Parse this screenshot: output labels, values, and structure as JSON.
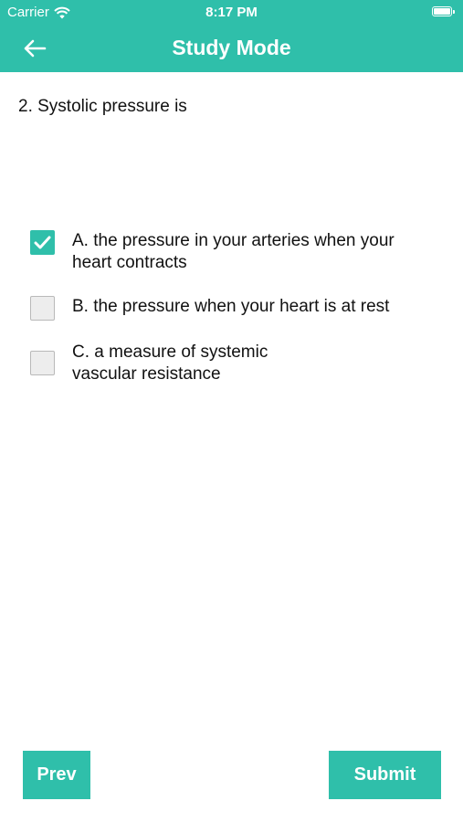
{
  "status_bar": {
    "carrier": "Carrier",
    "time": "8:17 PM"
  },
  "header": {
    "title": "Study Mode",
    "back_icon": "arrow-left-icon"
  },
  "question": {
    "text": "2. Systolic pressure is"
  },
  "options": [
    {
      "label": "A. the pressure in your arteries when your\nheart contracts",
      "checked": true
    },
    {
      "label": "B. the pressure when your heart is at rest",
      "checked": false
    },
    {
      "label": "C. a measure of systemic\nvascular resistance",
      "checked": false
    }
  ],
  "footer": {
    "prev_label": "Prev",
    "submit_label": "Submit"
  },
  "colors": {
    "accent": "#2fbfaa",
    "checkbox_bg": "#ededed",
    "checkbox_border": "#b9b9b9"
  }
}
